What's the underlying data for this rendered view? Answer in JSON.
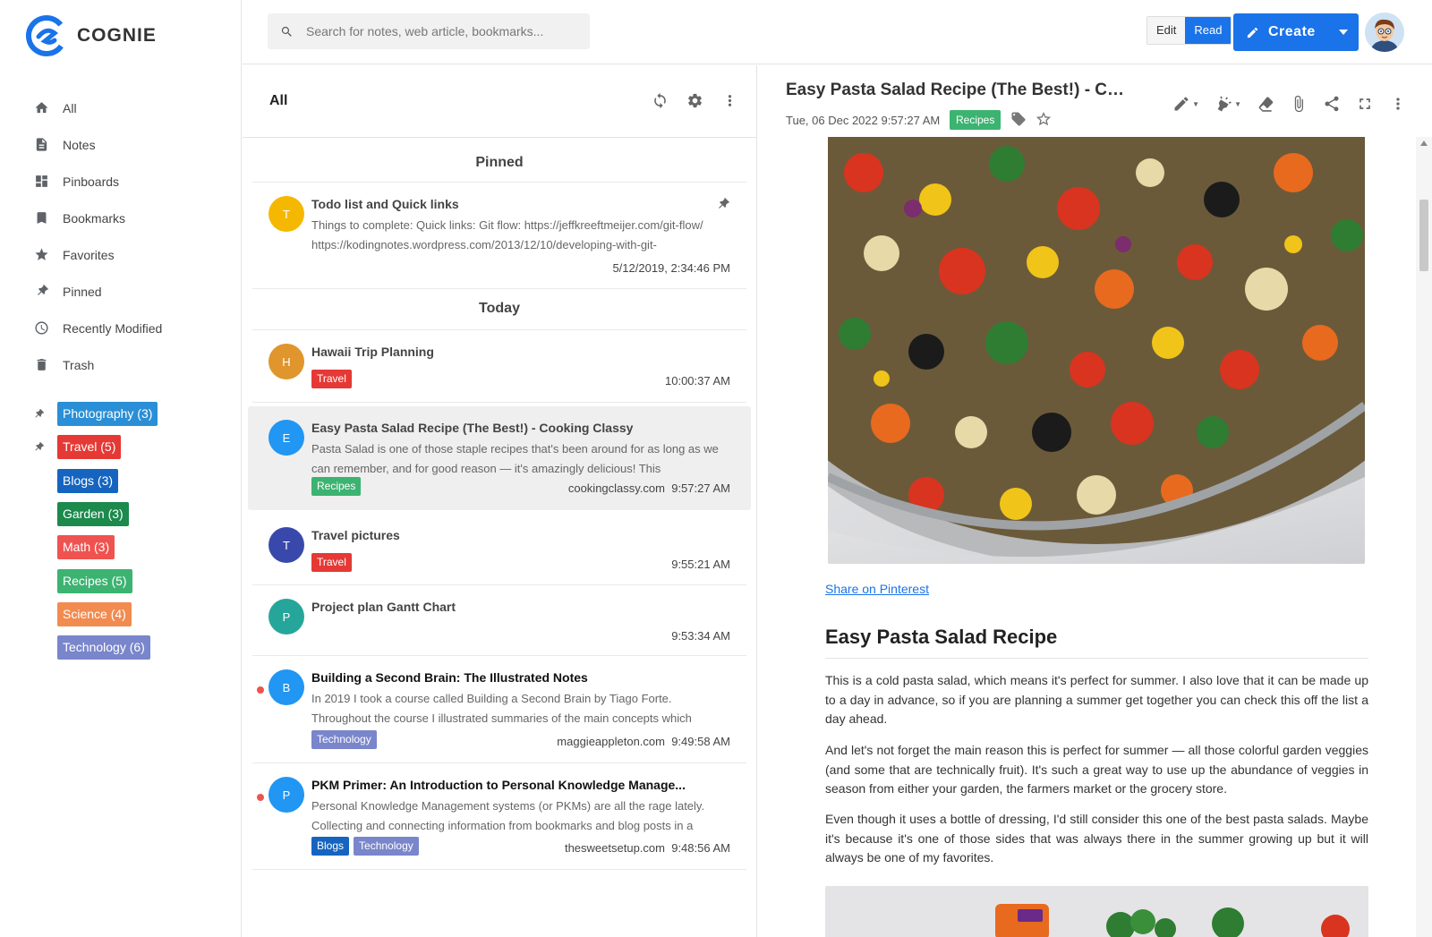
{
  "app": {
    "name": "COGNIE",
    "brand_color": "#1a73e8"
  },
  "sidebar": {
    "nav": [
      {
        "label": "All",
        "icon": "home-icon"
      },
      {
        "label": "Notes",
        "icon": "note-icon"
      },
      {
        "label": "Pinboards",
        "icon": "pinboard-icon"
      },
      {
        "label": "Bookmarks",
        "icon": "bookmark-icon"
      },
      {
        "label": "Favorites",
        "icon": "star-icon"
      },
      {
        "label": "Pinned",
        "icon": "pin-icon"
      },
      {
        "label": "Recently Modified",
        "icon": "clock-icon"
      },
      {
        "label": "Trash",
        "icon": "trash-icon"
      }
    ],
    "tags": [
      {
        "label": "Photography (3)",
        "color": "#2a8fd6",
        "pinned": true
      },
      {
        "label": "Travel (5)",
        "color": "#e53935",
        "pinned": true
      },
      {
        "label": "Blogs (3)",
        "color": "#1565c0",
        "pinned": false
      },
      {
        "label": "Garden (3)",
        "color": "#1b8a4c",
        "pinned": false
      },
      {
        "label": "Math (3)",
        "color": "#ef5350",
        "pinned": false
      },
      {
        "label": "Recipes (5)",
        "color": "#3cb371",
        "pinned": false
      },
      {
        "label": "Science (4)",
        "color": "#f28b50",
        "pinned": false
      },
      {
        "label": "Technology (6)",
        "color": "#7986cb",
        "pinned": false
      }
    ]
  },
  "topbar": {
    "search_placeholder": "Search for notes, web article, bookmarks...",
    "edit_label": "Edit",
    "read_label": "Read",
    "create_label": "Create"
  },
  "list": {
    "title": "All",
    "pinned_heading": "Pinned",
    "today_heading": "Today",
    "pinned_note": {
      "initial": "T",
      "avatar_color": "#f5b800",
      "title": "Todo list and Quick links",
      "excerpt": "Things to complete:   Quick links: Git flow: https://jeffkreeftmeijer.com/git-flow/ https://kodingnotes.wordpress.com/2013/12/10/developing-with-git-",
      "time": "5/12/2019, 2:34:46 PM"
    },
    "notes": [
      {
        "initial": "H",
        "avatar_color": "#e0952d",
        "title": "Hawaii Trip Planning",
        "excerpt": "",
        "tags": [
          {
            "label": "Travel",
            "color": "#e53935"
          }
        ],
        "source": "",
        "time": "10:00:37 AM",
        "unread": false
      },
      {
        "initial": "E",
        "avatar_color": "#2196f3",
        "title": "Easy Pasta Salad Recipe (The Best!) - Cooking Classy",
        "excerpt": "Pasta Salad is one of those staple recipes that's been around for as long as we can remember, and for good reason — it's amazingly delicious! This",
        "tags": [
          {
            "label": "Recipes",
            "color": "#3cb371"
          }
        ],
        "source": "cookingclassy.com",
        "time": "9:57:27 AM",
        "unread": false
      },
      {
        "initial": "T",
        "avatar_color": "#3949ab",
        "title": "Travel pictures",
        "excerpt": "",
        "tags": [
          {
            "label": "Travel",
            "color": "#e53935"
          }
        ],
        "source": "",
        "time": "9:55:21 AM",
        "unread": false
      },
      {
        "initial": "P",
        "avatar_color": "#26a69a",
        "title": "Project plan Gantt Chart",
        "excerpt": "",
        "tags": [],
        "source": "",
        "time": "9:53:34 AM",
        "unread": false
      },
      {
        "initial": "B",
        "avatar_color": "#2196f3",
        "title": "Building a Second Brain: The Illustrated Notes",
        "excerpt": "In 2019 I took a course called Building a Second Brain by Tiago Forte. Throughout the course I illustrated summaries of the main concepts which",
        "tags": [
          {
            "label": "Technology",
            "color": "#7986cb"
          }
        ],
        "source": "maggieappleton.com",
        "time": "9:49:58 AM",
        "unread": true
      },
      {
        "initial": "P",
        "avatar_color": "#2196f3",
        "title": "PKM Primer: An Introduction to Personal Knowledge Manage...",
        "excerpt": "Personal Knowledge Management systems (or PKMs) are all the rage lately. Collecting and connecting information from bookmarks and blog posts in a",
        "tags": [
          {
            "label": "Blogs",
            "color": "#1565c0"
          },
          {
            "label": "Technology",
            "color": "#7986cb"
          }
        ],
        "source": "thesweetsetup.com",
        "time": "9:48:56 AM",
        "unread": true
      }
    ]
  },
  "reader": {
    "title": "Easy Pasta Salad Recipe (The Best!) - Coo...",
    "date": "Tue, 06 Dec 2022 9:57:27 AM",
    "tag": "Recipes",
    "share_link": "Share on Pinterest",
    "heading": "Easy Pasta Salad Recipe",
    "paragraphs": [
      "This is a cold pasta salad, which means it's perfect for summer. I also love that it can be made up to a day in advance, so if you are planning a summer get together you can check this off the list a day ahead.",
      "And let's not forget the main reason this is perfect for summer — all those colorful garden veggies (and some that are technically fruit). It's such a great way to use up the abundance of veggies in season from either your garden, the farmers market or the grocery store.",
      "Even though it uses a bottle of dressing, I'd still consider this one of the best pasta salads. Maybe it's because it's one of those sides that was always there in the summer growing up but it will always be one of my favorites."
    ]
  }
}
